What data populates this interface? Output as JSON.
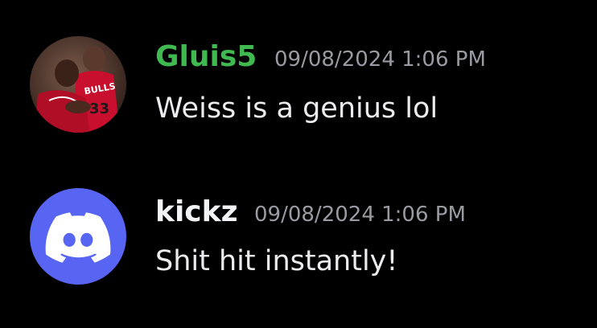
{
  "messages": [
    {
      "username": "Gluis5",
      "username_color": "#3fb950",
      "timestamp": "09/08/2024 1:06 PM",
      "text": "Weiss is a genius lol",
      "avatar": "photo-avatar"
    },
    {
      "username": "kickz",
      "username_color": "#f2f3f5",
      "timestamp": "09/08/2024 1:06 PM",
      "text": "Shit hit instantly!",
      "avatar": "discord-logo-icon",
      "avatar_color": "#5865f2"
    }
  ]
}
